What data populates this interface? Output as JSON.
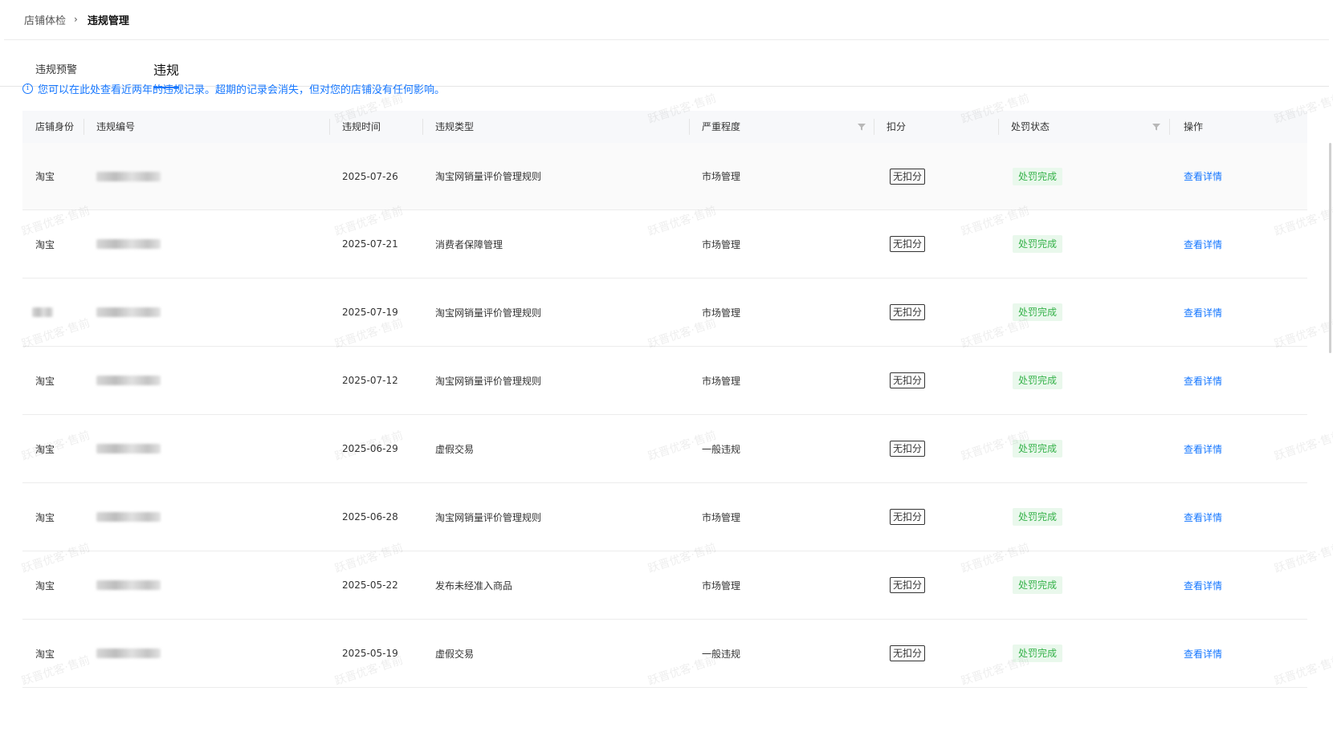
{
  "breadcrumb": {
    "parent": "店铺体检",
    "separator": "›",
    "current": "违规管理"
  },
  "tabs": [
    {
      "label": "违规预警"
    },
    {
      "label": "违规"
    }
  ],
  "notice": {
    "text": "您可以在此处查看近两年的违规记录。超期的记录会消失，但对您的店铺没有任何影响。"
  },
  "table": {
    "headers": {
      "shop_identity": "店铺身份",
      "violation_no": "违规编号",
      "violation_time": "违规时间",
      "violation_type": "违规类型",
      "severity": "严重程度",
      "deduction": "扣分",
      "penalty_status": "处罚状态",
      "action": "操作"
    },
    "rows": [
      {
        "shop": "淘宝",
        "date": "2025-07-26",
        "type": "淘宝网销量评价管理规则",
        "severity": "市场管理",
        "deduction": "无扣分",
        "status": "处罚完成",
        "action": "查看详情"
      },
      {
        "shop": "淘宝",
        "date": "2025-07-21",
        "type": "消费者保障管理",
        "severity": "市场管理",
        "deduction": "无扣分",
        "status": "处罚完成",
        "action": "查看详情"
      },
      {
        "shop": "",
        "date": "2025-07-19",
        "type": "淘宝网销量评价管理规则",
        "severity": "市场管理",
        "deduction": "无扣分",
        "status": "处罚完成",
        "action": "查看详情"
      },
      {
        "shop": "淘宝",
        "date": "2025-07-12",
        "type": "淘宝网销量评价管理规则",
        "severity": "市场管理",
        "deduction": "无扣分",
        "status": "处罚完成",
        "action": "查看详情"
      },
      {
        "shop": "淘宝",
        "date": "2025-06-29",
        "type": "虚假交易",
        "severity": "一般违规",
        "deduction": "无扣分",
        "status": "处罚完成",
        "action": "查看详情"
      },
      {
        "shop": "淘宝",
        "date": "2025-06-28",
        "type": "淘宝网销量评价管理规则",
        "severity": "市场管理",
        "deduction": "无扣分",
        "status": "处罚完成",
        "action": "查看详情"
      },
      {
        "shop": "淘宝",
        "date": "2025-05-22",
        "type": "发布未经准入商品",
        "severity": "市场管理",
        "deduction": "无扣分",
        "status": "处罚完成",
        "action": "查看详情"
      },
      {
        "shop": "淘宝",
        "date": "2025-05-19",
        "type": "虚假交易",
        "severity": "一般违规",
        "deduction": "无扣分",
        "status": "处罚完成",
        "action": "查看详情"
      }
    ]
  },
  "watermark": {
    "text": "跃晋优客·售前"
  },
  "colors": {
    "link": "#1677ff",
    "status_text": "#36b24a",
    "status_bg": "#e9f8ec",
    "header_bg": "#f7f8fa"
  },
  "icons": {
    "notice": "info-circle-icon",
    "breadcrumb_sep": "chevron-right-icon",
    "column_filter": "filter-funnel-icon"
  }
}
